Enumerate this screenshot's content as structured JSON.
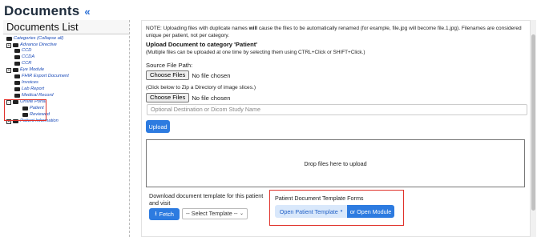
{
  "header": {
    "title": "Documents",
    "collapse_icon": "«"
  },
  "left": {
    "list_title": "Documents List",
    "tree": [
      {
        "label": "Categories (Collapse all)",
        "level": 0,
        "toggle": ""
      },
      {
        "label": "Advance Directive",
        "level": 1,
        "toggle": "+"
      },
      {
        "label": "CCD",
        "level": 2,
        "toggle": ""
      },
      {
        "label": "CCDA",
        "level": 2,
        "toggle": ""
      },
      {
        "label": "CCR",
        "level": 2,
        "toggle": ""
      },
      {
        "label": "Eye Module",
        "level": 1,
        "toggle": "+"
      },
      {
        "label": "FHIR Export Document",
        "level": 2,
        "toggle": ""
      },
      {
        "label": "Invoices",
        "level": 2,
        "toggle": ""
      },
      {
        "label": "Lab Report",
        "level": 2,
        "toggle": ""
      },
      {
        "label": "Medical Record",
        "level": 2,
        "toggle": ""
      },
      {
        "label": "Onsite Portal",
        "level": 1,
        "toggle": "-"
      },
      {
        "label": "Patient",
        "level": 3,
        "toggle": ""
      },
      {
        "label": "Reviewed",
        "level": 3,
        "toggle": ""
      },
      {
        "label": "Patient Information",
        "level": 1,
        "toggle": "+"
      }
    ]
  },
  "main": {
    "note_prefix": "NOTE: Uploading files with duplicate names",
    "note_bold": "will",
    "note_suffix": "cause the files to be automatically renamed (for example, file.jpg will become file.1.jpg). Filenames are considered unique per patient, not per category.",
    "upload_heading": "Upload Document to category 'Patient'",
    "upload_sub": "(Multiple files can be uploaded at one time by selecting them using CTRL+Click or SHIFT+Click.)",
    "source_label": "Source File Path:",
    "choose_files": "Choose Files",
    "no_file": "No file chosen",
    "zip_label": "(Click below to Zip a Directory of image slices.)",
    "choose_files_2": "Choose Files",
    "no_file_2": "No file chosen",
    "destination_placeholder": "Optional Destination or Dicom Study Name",
    "upload_button": "Upload",
    "dropzone_text": "Drop files here to upload",
    "download_label": "Download document template for this patient and visit",
    "fetch_button": "Fetch",
    "select_template": "-- Select Template --",
    "forms_label": "Patient Document Template Forms",
    "open_template_button": "Open Patient Template",
    "open_module_button": "or Open Module"
  },
  "colors": {
    "accent": "#2d7be0",
    "highlight": "#e0312a",
    "link": "#1a4ab8"
  }
}
